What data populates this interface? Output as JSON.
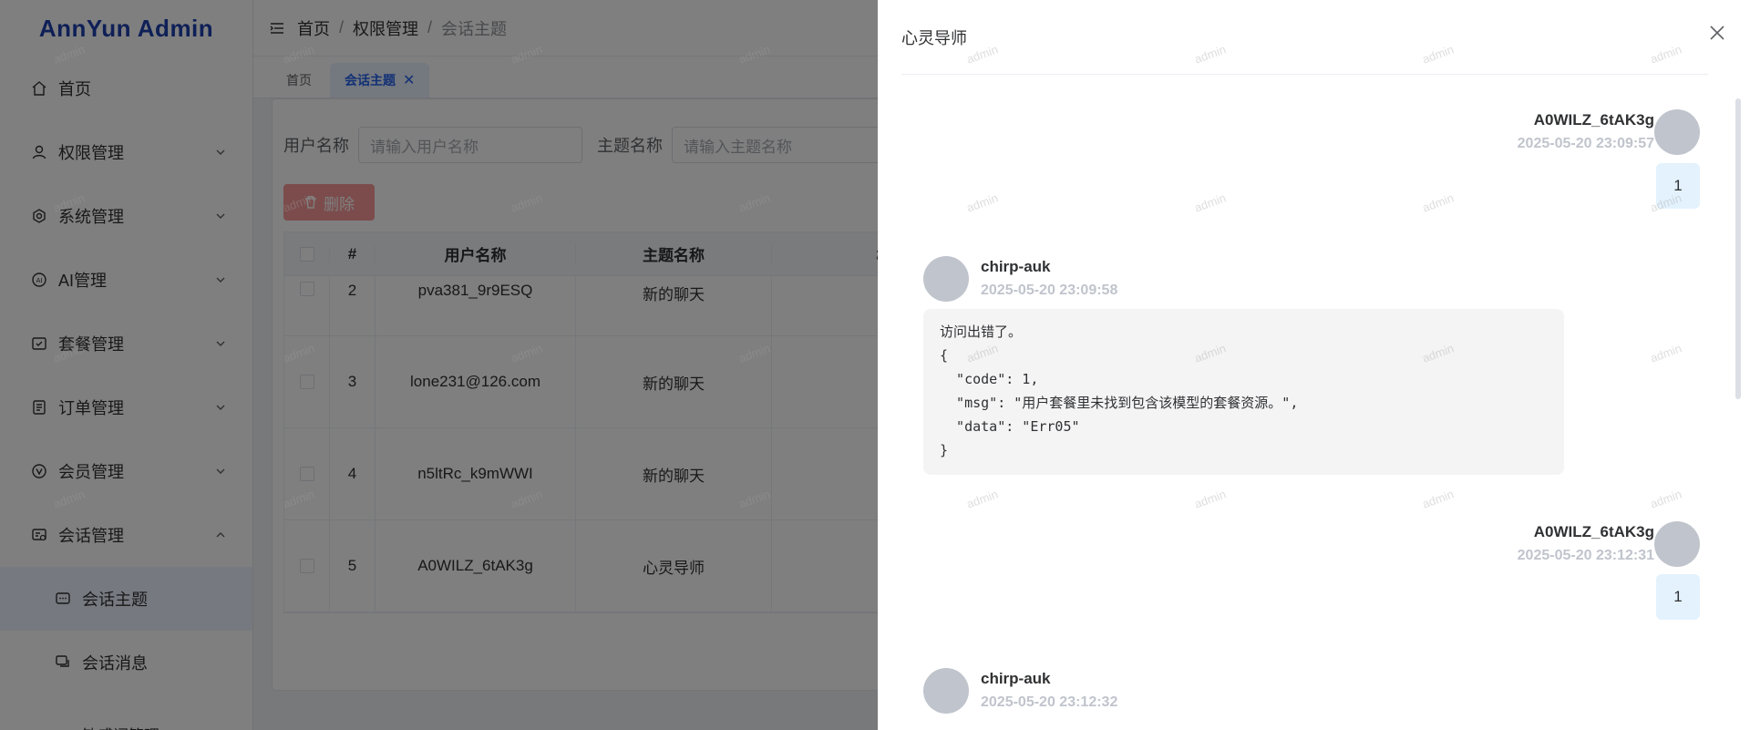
{
  "app": {
    "title": "AnnYun Admin"
  },
  "sidebar": {
    "items": [
      {
        "label": "首页",
        "icon": "home-icon"
      },
      {
        "label": "权限管理",
        "icon": "user-icon"
      },
      {
        "label": "系统管理",
        "icon": "gear-icon"
      },
      {
        "label": "AI管理",
        "icon": "ai-icon"
      },
      {
        "label": "套餐管理",
        "icon": "package-icon"
      },
      {
        "label": "订单管理",
        "icon": "order-icon"
      },
      {
        "label": "会员管理",
        "icon": "vip-icon"
      },
      {
        "label": "会话管理",
        "icon": "chat-manage-icon"
      }
    ],
    "sub_items": [
      {
        "label": "会话主题",
        "icon": "chat-topic-icon"
      },
      {
        "label": "会话消息",
        "icon": "chat-message-icon"
      },
      {
        "label": "敏感词管理"
      }
    ]
  },
  "header": {
    "breadcrumb": [
      "首页",
      "权限管理",
      "会话主题"
    ]
  },
  "tabs": [
    {
      "label": "首页"
    },
    {
      "label": "会话主题"
    }
  ],
  "filters": {
    "user_label": "用户名称",
    "user_placeholder": "请输入用户名称",
    "topic_label": "主题名称",
    "topic_placeholder": "请输入主题名称"
  },
  "toolbar": {
    "delete_label": "删除"
  },
  "table": {
    "headers": [
      "#",
      "用户名称",
      "主题名称",
      "概述"
    ],
    "rows": [
      {
        "no": "2",
        "user": "pva381_9r9ESQ",
        "topic": "新的聊天"
      },
      {
        "no": "3",
        "user": "lone231@126.com",
        "topic": "新的聊天"
      },
      {
        "no": "4",
        "user": "n5ltRc_k9mWWI",
        "topic": "新的聊天"
      },
      {
        "no": "5",
        "user": "A0WILZ_6tAK3g",
        "topic": "心灵导师"
      }
    ]
  },
  "drawer": {
    "title": "心灵导师",
    "messages": [
      {
        "side": "right",
        "name": "A0WILZ_6tAK3g",
        "time": "2025-05-20 23:09:57",
        "text": "1"
      },
      {
        "side": "left",
        "name": "chirp-auk",
        "time": "2025-05-20 23:09:58",
        "text_first": "访问出错了。",
        "text_rest": "{\n  \"code\": 1,\n  \"msg\": \"用户套餐里未找到包含该模型的套餐资源。\",\n  \"data\": \"Err05\"\n}"
      },
      {
        "side": "right",
        "name": "A0WILZ_6tAK3g",
        "time": "2025-05-20 23:12:31",
        "text": "1"
      },
      {
        "side": "left",
        "name": "chirp-auk",
        "time": "2025-05-20 23:12:32"
      }
    ]
  },
  "watermark": "admin",
  "colors": {
    "brand": "#1e40af",
    "accent": "#2563eb",
    "danger_light": "#f89898"
  }
}
